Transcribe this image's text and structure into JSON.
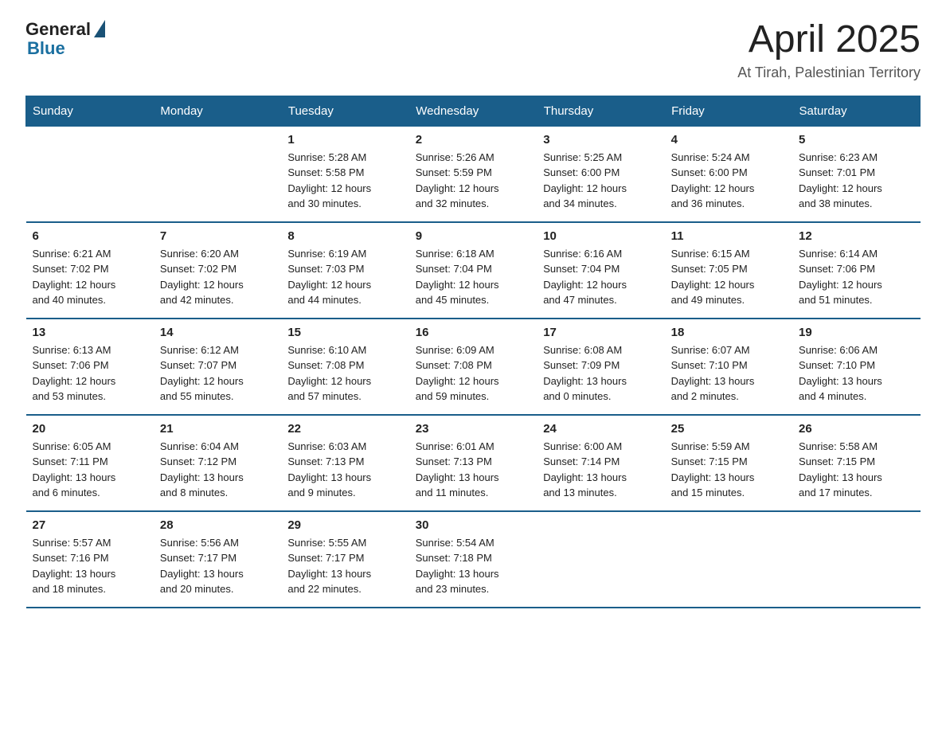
{
  "logo": {
    "general": "General",
    "blue": "Blue"
  },
  "header": {
    "title": "April 2025",
    "subtitle": "At Tirah, Palestinian Territory"
  },
  "weekdays": [
    "Sunday",
    "Monday",
    "Tuesday",
    "Wednesday",
    "Thursday",
    "Friday",
    "Saturday"
  ],
  "weeks": [
    [
      {
        "day": "",
        "info": ""
      },
      {
        "day": "",
        "info": ""
      },
      {
        "day": "1",
        "info": "Sunrise: 5:28 AM\nSunset: 5:58 PM\nDaylight: 12 hours\nand 30 minutes."
      },
      {
        "day": "2",
        "info": "Sunrise: 5:26 AM\nSunset: 5:59 PM\nDaylight: 12 hours\nand 32 minutes."
      },
      {
        "day": "3",
        "info": "Sunrise: 5:25 AM\nSunset: 6:00 PM\nDaylight: 12 hours\nand 34 minutes."
      },
      {
        "day": "4",
        "info": "Sunrise: 5:24 AM\nSunset: 6:00 PM\nDaylight: 12 hours\nand 36 minutes."
      },
      {
        "day": "5",
        "info": "Sunrise: 6:23 AM\nSunset: 7:01 PM\nDaylight: 12 hours\nand 38 minutes."
      }
    ],
    [
      {
        "day": "6",
        "info": "Sunrise: 6:21 AM\nSunset: 7:02 PM\nDaylight: 12 hours\nand 40 minutes."
      },
      {
        "day": "7",
        "info": "Sunrise: 6:20 AM\nSunset: 7:02 PM\nDaylight: 12 hours\nand 42 minutes."
      },
      {
        "day": "8",
        "info": "Sunrise: 6:19 AM\nSunset: 7:03 PM\nDaylight: 12 hours\nand 44 minutes."
      },
      {
        "day": "9",
        "info": "Sunrise: 6:18 AM\nSunset: 7:04 PM\nDaylight: 12 hours\nand 45 minutes."
      },
      {
        "day": "10",
        "info": "Sunrise: 6:16 AM\nSunset: 7:04 PM\nDaylight: 12 hours\nand 47 minutes."
      },
      {
        "day": "11",
        "info": "Sunrise: 6:15 AM\nSunset: 7:05 PM\nDaylight: 12 hours\nand 49 minutes."
      },
      {
        "day": "12",
        "info": "Sunrise: 6:14 AM\nSunset: 7:06 PM\nDaylight: 12 hours\nand 51 minutes."
      }
    ],
    [
      {
        "day": "13",
        "info": "Sunrise: 6:13 AM\nSunset: 7:06 PM\nDaylight: 12 hours\nand 53 minutes."
      },
      {
        "day": "14",
        "info": "Sunrise: 6:12 AM\nSunset: 7:07 PM\nDaylight: 12 hours\nand 55 minutes."
      },
      {
        "day": "15",
        "info": "Sunrise: 6:10 AM\nSunset: 7:08 PM\nDaylight: 12 hours\nand 57 minutes."
      },
      {
        "day": "16",
        "info": "Sunrise: 6:09 AM\nSunset: 7:08 PM\nDaylight: 12 hours\nand 59 minutes."
      },
      {
        "day": "17",
        "info": "Sunrise: 6:08 AM\nSunset: 7:09 PM\nDaylight: 13 hours\nand 0 minutes."
      },
      {
        "day": "18",
        "info": "Sunrise: 6:07 AM\nSunset: 7:10 PM\nDaylight: 13 hours\nand 2 minutes."
      },
      {
        "day": "19",
        "info": "Sunrise: 6:06 AM\nSunset: 7:10 PM\nDaylight: 13 hours\nand 4 minutes."
      }
    ],
    [
      {
        "day": "20",
        "info": "Sunrise: 6:05 AM\nSunset: 7:11 PM\nDaylight: 13 hours\nand 6 minutes."
      },
      {
        "day": "21",
        "info": "Sunrise: 6:04 AM\nSunset: 7:12 PM\nDaylight: 13 hours\nand 8 minutes."
      },
      {
        "day": "22",
        "info": "Sunrise: 6:03 AM\nSunset: 7:13 PM\nDaylight: 13 hours\nand 9 minutes."
      },
      {
        "day": "23",
        "info": "Sunrise: 6:01 AM\nSunset: 7:13 PM\nDaylight: 13 hours\nand 11 minutes."
      },
      {
        "day": "24",
        "info": "Sunrise: 6:00 AM\nSunset: 7:14 PM\nDaylight: 13 hours\nand 13 minutes."
      },
      {
        "day": "25",
        "info": "Sunrise: 5:59 AM\nSunset: 7:15 PM\nDaylight: 13 hours\nand 15 minutes."
      },
      {
        "day": "26",
        "info": "Sunrise: 5:58 AM\nSunset: 7:15 PM\nDaylight: 13 hours\nand 17 minutes."
      }
    ],
    [
      {
        "day": "27",
        "info": "Sunrise: 5:57 AM\nSunset: 7:16 PM\nDaylight: 13 hours\nand 18 minutes."
      },
      {
        "day": "28",
        "info": "Sunrise: 5:56 AM\nSunset: 7:17 PM\nDaylight: 13 hours\nand 20 minutes."
      },
      {
        "day": "29",
        "info": "Sunrise: 5:55 AM\nSunset: 7:17 PM\nDaylight: 13 hours\nand 22 minutes."
      },
      {
        "day": "30",
        "info": "Sunrise: 5:54 AM\nSunset: 7:18 PM\nDaylight: 13 hours\nand 23 minutes."
      },
      {
        "day": "",
        "info": ""
      },
      {
        "day": "",
        "info": ""
      },
      {
        "day": "",
        "info": ""
      }
    ]
  ]
}
